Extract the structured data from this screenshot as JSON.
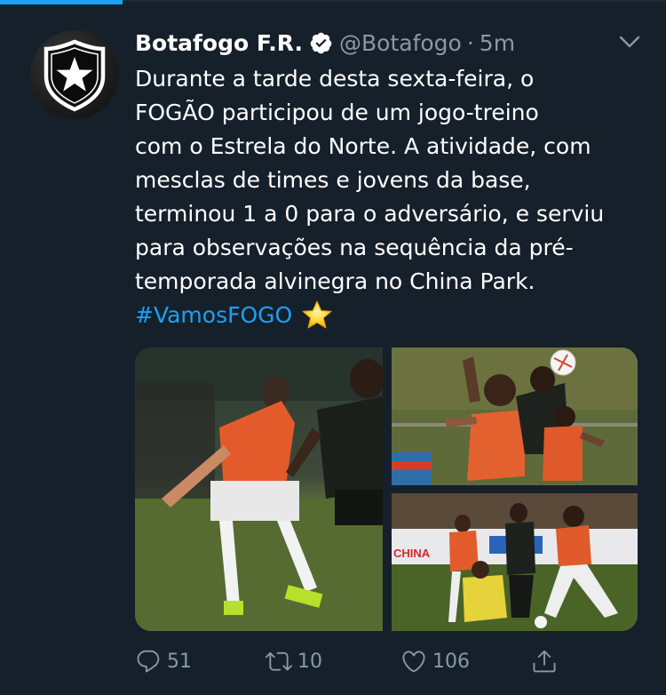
{
  "tweet": {
    "author": {
      "display_name": "Botafogo F.R.",
      "handle": "@Botafogo",
      "verified": true,
      "avatar_icon": "botafogo-crest"
    },
    "separator": "·",
    "time": "5m",
    "text_lines": [
      "Durante a tarde desta sexta-feira, o",
      "FOGÃO participou de um jogo-treino",
      "com o Estrela do Norte. A atividade, com",
      "mesclas de times e jovens da base,",
      "terminou 1 a 0 para o adversário, e serviu",
      "para observações na sequência da pré-",
      "temporada alvinegra no China Park."
    ],
    "hashtag": "#VamosFOGO",
    "emoji": "star-emoji",
    "media": [
      {
        "description": "football players contesting the ball on a training pitch",
        "name": "photo-1"
      },
      {
        "description": "players jumping for a header",
        "name": "photo-2"
      },
      {
        "description": "players running with the ball",
        "name": "photo-3"
      }
    ],
    "ad_board_text": "CHINA",
    "actions": {
      "reply": {
        "icon": "reply-icon",
        "count": "51"
      },
      "retweet": {
        "icon": "retweet-icon",
        "count": "10"
      },
      "like": {
        "icon": "heart-icon",
        "count": "106"
      },
      "share": {
        "icon": "share-icon"
      }
    }
  },
  "colors": {
    "background": "#15202b",
    "text_primary": "#ffffff",
    "text_secondary": "#8899a6",
    "accent": "#1da1f2"
  }
}
